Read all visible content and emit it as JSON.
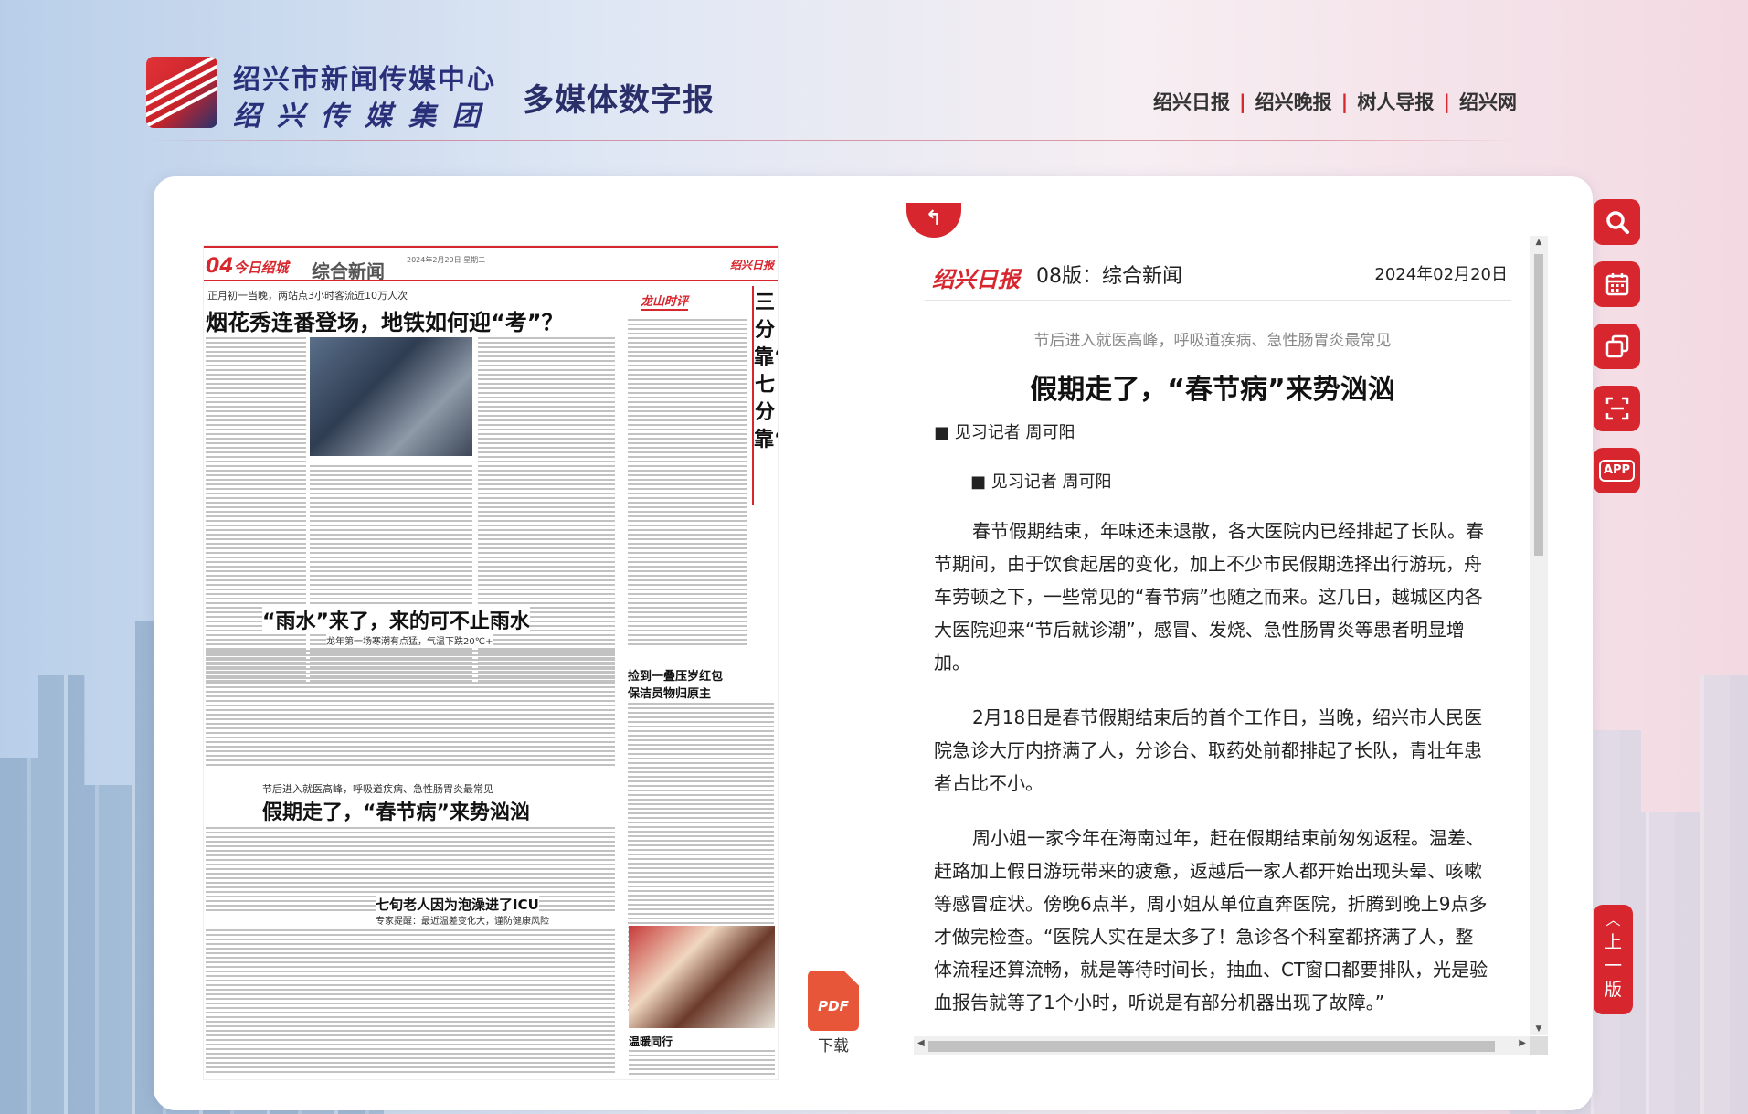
{
  "header": {
    "org_line1": "绍兴市新闻传媒中心",
    "org_line2": "绍兴传媒集团",
    "subtitle": "多媒体数字报",
    "nav": [
      "绍兴日报",
      "绍兴晚报",
      "树人导报",
      "绍兴网"
    ],
    "nav_separator": "|"
  },
  "paper": {
    "page_no": "04",
    "page_brand": "今日绍城",
    "section": "综合新闻",
    "paper_logo": "绍兴日报",
    "date_small": "2024年2月20日  星期二",
    "story1_kicker": "正月初一当晚，两站点3小时客流近10万人次",
    "story1_title": "烟花秀连番登场，地铁如何迎“考”？",
    "story2_title": "“雨水”来了，来的可不止雨水",
    "story2_sub": "龙年第一场寒潮有点猛，气温下跌20℃+",
    "story3_kicker": "节后进入就医高峰，呼吸道疾病、急性肠胃炎最常见",
    "story3_title": "假期走了，“春节病”来势汹汹",
    "story4_title": "七旬老人因为泡澡进了ICU",
    "story4_sub": "专家提醒：最近温差变化大，谨防健康风险",
    "story5_title": "捡到一叠压岁红包 保洁员物归原主",
    "column_tag": "龙山时评",
    "vertical_title": "三分靠“抢”，七分靠“留”",
    "photo_caption": "温暖同行"
  },
  "pdf": {
    "label": "下载",
    "icon": "pdf-file-icon",
    "icon_text": "PDF"
  },
  "article": {
    "back_icon": "back-arrow-icon",
    "paper_logo": "绍兴日报",
    "page_label": "08版：综合新闻",
    "date": "2024年02月20日",
    "kicker": "节后进入就医高峰，呼吸道疾病、急性肠胃炎最常见",
    "title": "假期走了，“春节病”来势汹汹",
    "byline": "■ 见习记者 周可阳",
    "paragraphs": [
      "春节假期结束，年味还未退散，各大医院内已经排起了长队。春节期间，由于饮食起居的变化，加上不少市民假期选择出行游玩，舟车劳顿之下，一些常见的“春节病”也随之而来。这几日，越城区内各大医院迎来“节后就诊潮”，感冒、发烧、急性肠胃炎等患者明显增加。",
      "2月18日是春节假期结束后的首个工作日，当晚，绍兴市人民医院急诊大厅内挤满了人，分诊台、取药处前都排起了长队，青壮年患者占比不小。",
      "周小姐一家今年在海南过年，赶在假期结束前匆匆返程。温差、赶路加上假日游玩带来的疲惫，返越后一家人都开始出现头晕、咳嗽等感冒症状。傍晚6点半，周小姐从单位直奔医院，折腾到晚上9点多才做完检查。“医院人实在是太多了！急诊各个科室都挤满了人，整体流程还算流畅，就是等待时间长，抽血、CT窗口都要排队，光是验血报告就等了1个小时，听说是有部分机器出现了故障。”"
    ]
  },
  "toolbar": {
    "tools": [
      "search-icon",
      "calendar-icon",
      "copy-icon",
      "scan-icon",
      "app-icon"
    ],
    "app_label": "APP",
    "prev_page": [
      "上",
      "一",
      "版"
    ]
  }
}
